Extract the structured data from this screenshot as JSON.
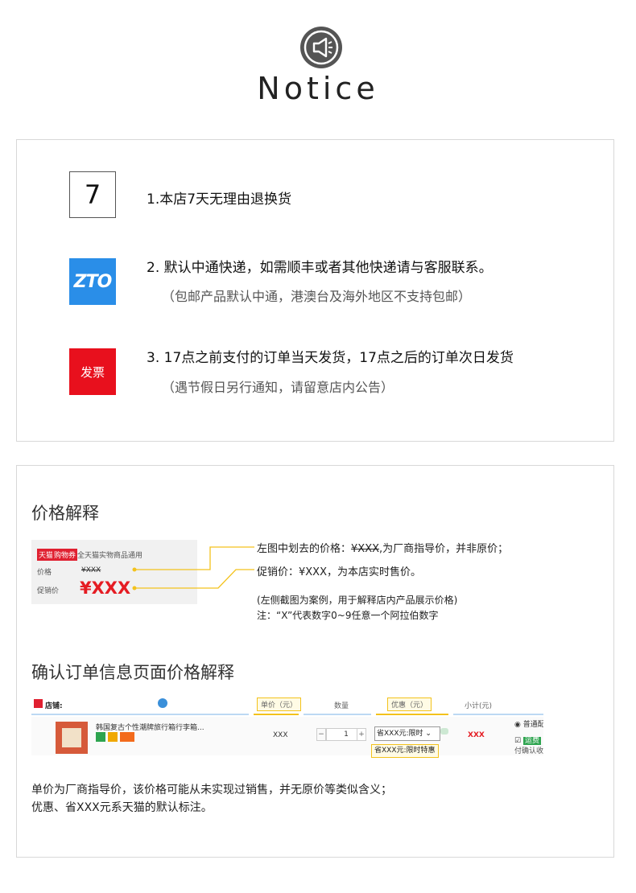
{
  "notice": {
    "title": "Notice",
    "icon": "megaphone-icon"
  },
  "policies": {
    "seven_day": {
      "badge": "7",
      "text": "1.本店7天无理由退换货"
    },
    "shipping": {
      "badge": "ZTO",
      "text": "2. 默认中通快递，如需顺丰或者其他快递请与客服联系。",
      "note": "（包邮产品默认中通，港澳台及海外地区不支持包邮）"
    },
    "invoice": {
      "badge": "发票",
      "text": "3. 17点之前支付的订单当天发货，17点之后的订单次日发货",
      "note": "（遇节假日另行通知，请留意店内公告）"
    }
  },
  "price_explain": {
    "heading": "价格解释",
    "mock": {
      "tag_tmall": "天猫",
      "tag_coupon": "购物券",
      "tag_text": "全天猫实物商品通用",
      "price_label": "价格",
      "price_value": "¥XXX",
      "promo_label": "促销价",
      "promo_value": "¥XXX"
    },
    "line1_prefix": "左图中划去的价格：",
    "line1_struck": "¥XXX",
    "line1_suffix": ",为厂商指导价，并非原价；",
    "line2": "促销价：¥XXX，为本店实时售价。",
    "note1": "(左侧截图为案例，用于解释店内产品展示价格)",
    "note2": "注：“X”代表数字0~9任意一个阿拉伯数字"
  },
  "order_explain": {
    "heading": "确认订单信息页面价格解释",
    "mock": {
      "store_label": "店铺:",
      "col_unit_price": "单价（元）",
      "col_qty": "数量",
      "col_discount": "优惠（元）",
      "col_subtotal": "小计(元)",
      "product_title": "韩国复古个性潮牌旅行箱行李箱...",
      "unit_price": "XXX",
      "qty": "1",
      "discount_select": "省XXX元:限时",
      "discount_tip": "省XXX元:限时特惠",
      "subtotal": "XXX",
      "shipping_option": "普通配",
      "checkbox_text": "运费",
      "confirm_text": "付确认收"
    },
    "desc1": "单价为厂商指导价，该价格可能从未实现过销售，并无原价等类似含义；",
    "desc2": "优惠、省XXX元系天猫的默认标注。"
  },
  "colors": {
    "zto_blue": "#2a8ee8",
    "invoice_red": "#e8101d",
    "price_red": "#e51c23",
    "highlight_yellow": "#f3c21c"
  }
}
